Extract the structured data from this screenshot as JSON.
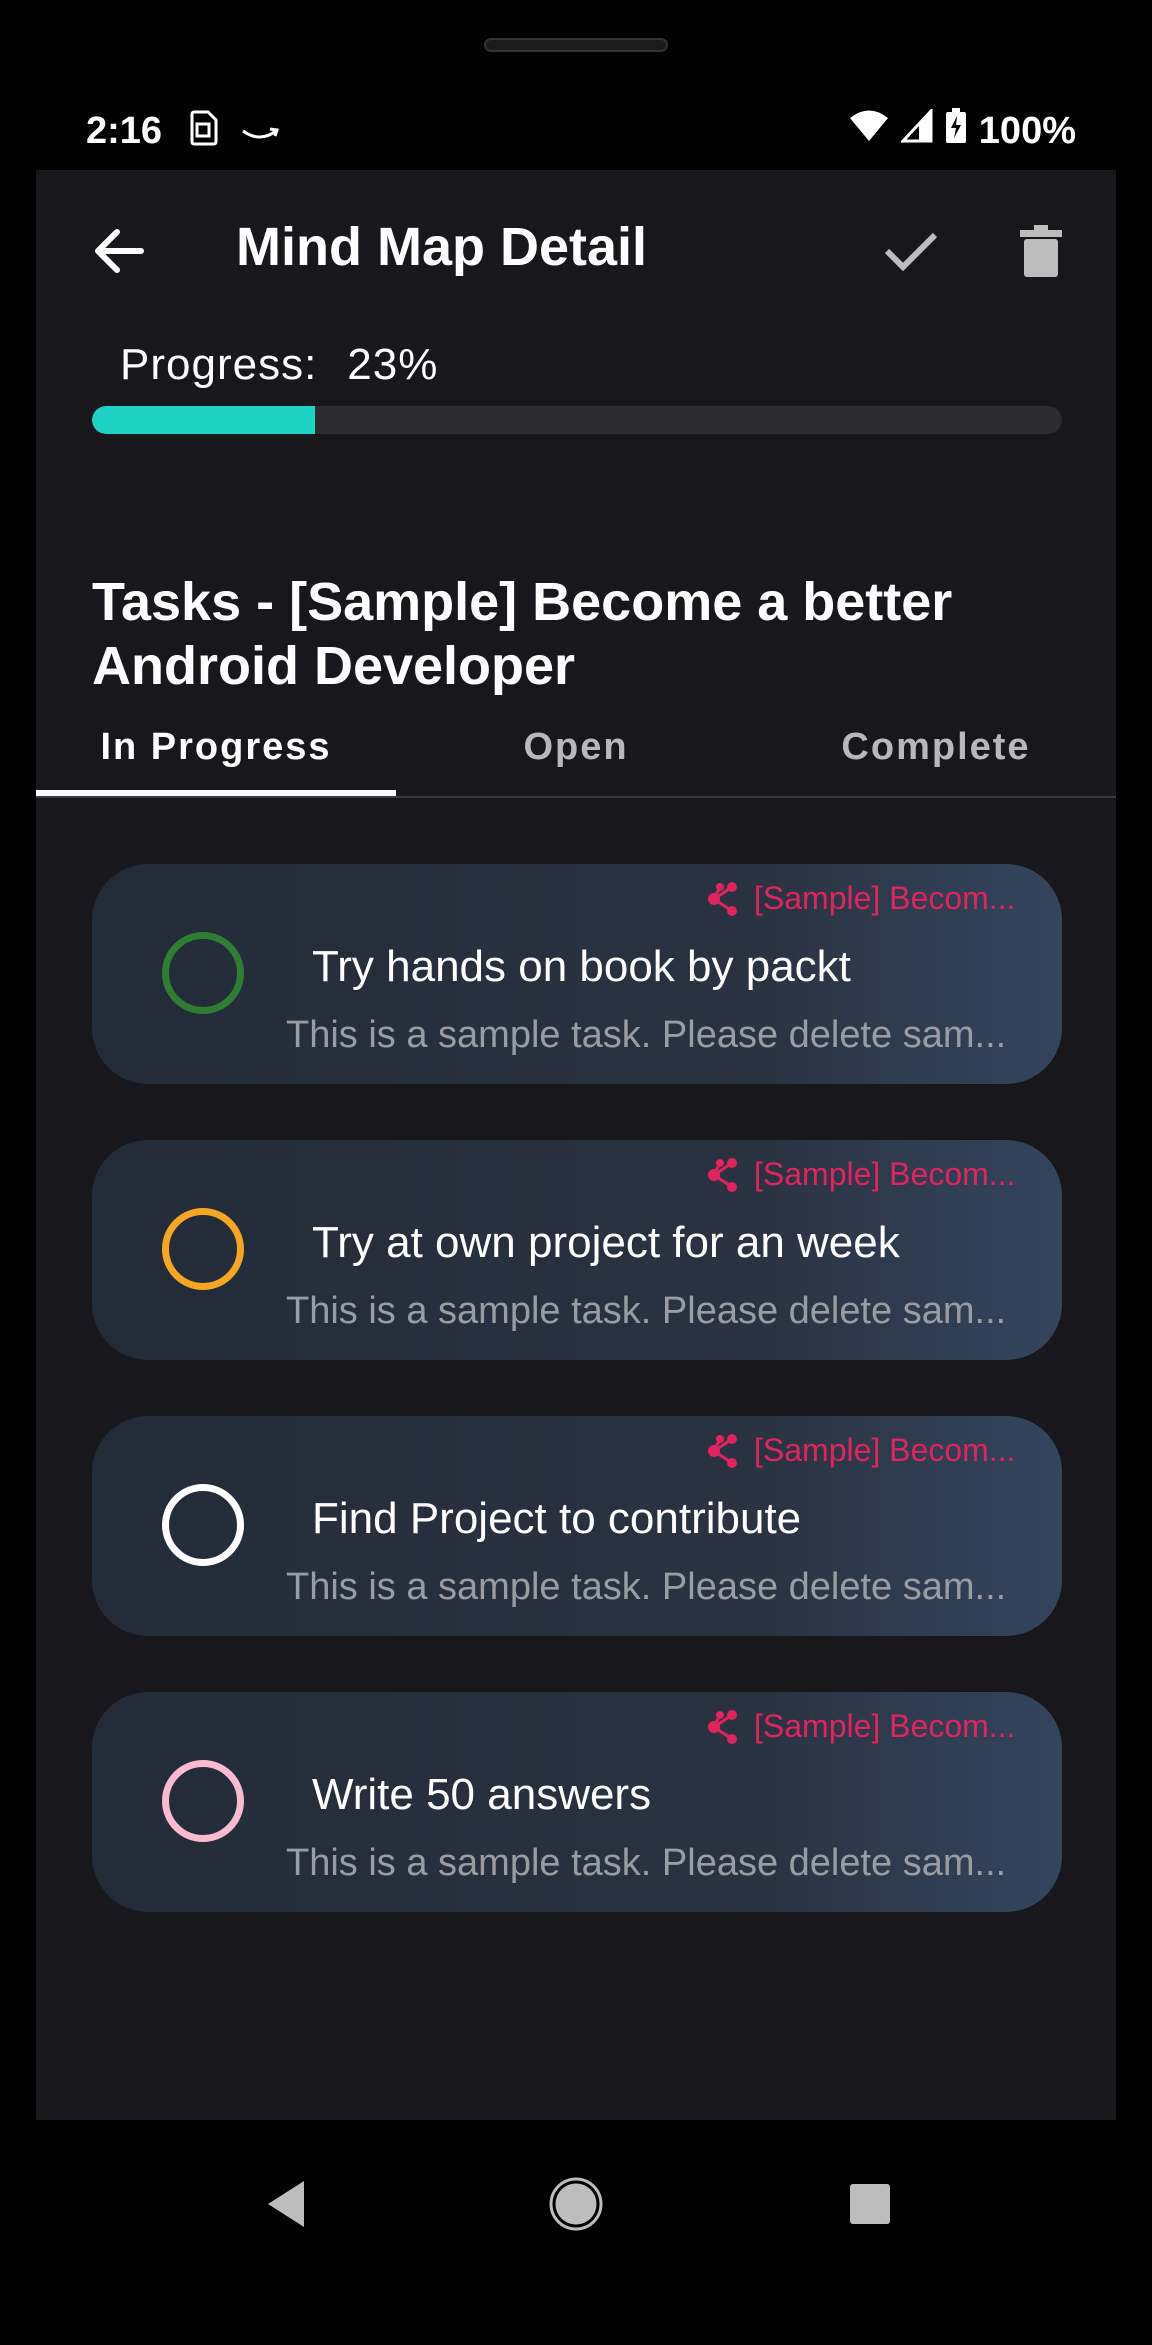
{
  "status_bar": {
    "time": "2:16",
    "battery": "100%",
    "icons": [
      "sim-icon",
      "amazon-icon",
      "wifi-icon",
      "signal-icon",
      "battery-charging-icon"
    ]
  },
  "app_bar": {
    "title": "Mind Map Detail",
    "icons": [
      "back-arrow-icon",
      "check-icon",
      "trash-icon"
    ]
  },
  "progress": {
    "label": "Progress:",
    "value_text": "23%",
    "value": 0.23,
    "color": "#1ed3c4"
  },
  "tasks": {
    "heading": "Tasks - [Sample] Become a better Android Developer",
    "tabs": [
      {
        "label": "In Progress",
        "active": true
      },
      {
        "label": "Open",
        "active": false
      },
      {
        "label": "Complete",
        "active": false
      }
    ],
    "items": [
      {
        "tag": "[Sample] Becom...",
        "title": "Try hands on book by packt",
        "description": "This is a sample task. Please delete sam...",
        "ring_color": "#2e7d32"
      },
      {
        "tag": "[Sample] Becom...",
        "title": "Try at own project for an week",
        "description": "This is a sample task. Please delete sam...",
        "ring_color": "#f5a623"
      },
      {
        "tag": "[Sample] Becom...",
        "title": "Find Project to contribute",
        "description": "This is a sample task. Please delete sam...",
        "ring_color": "#ffffff"
      },
      {
        "tag": "[Sample] Becom...",
        "title": "Write 50 answers",
        "description": "This is a sample task. Please delete sam...",
        "ring_color": "#f8bbd0"
      }
    ]
  },
  "nav_bar": {
    "icons": [
      "nav-back-icon",
      "nav-home-icon",
      "nav-recents-icon"
    ]
  },
  "colors": {
    "background": "#18181c",
    "card": "#262f3d",
    "accent_tag": "#e0245e"
  }
}
